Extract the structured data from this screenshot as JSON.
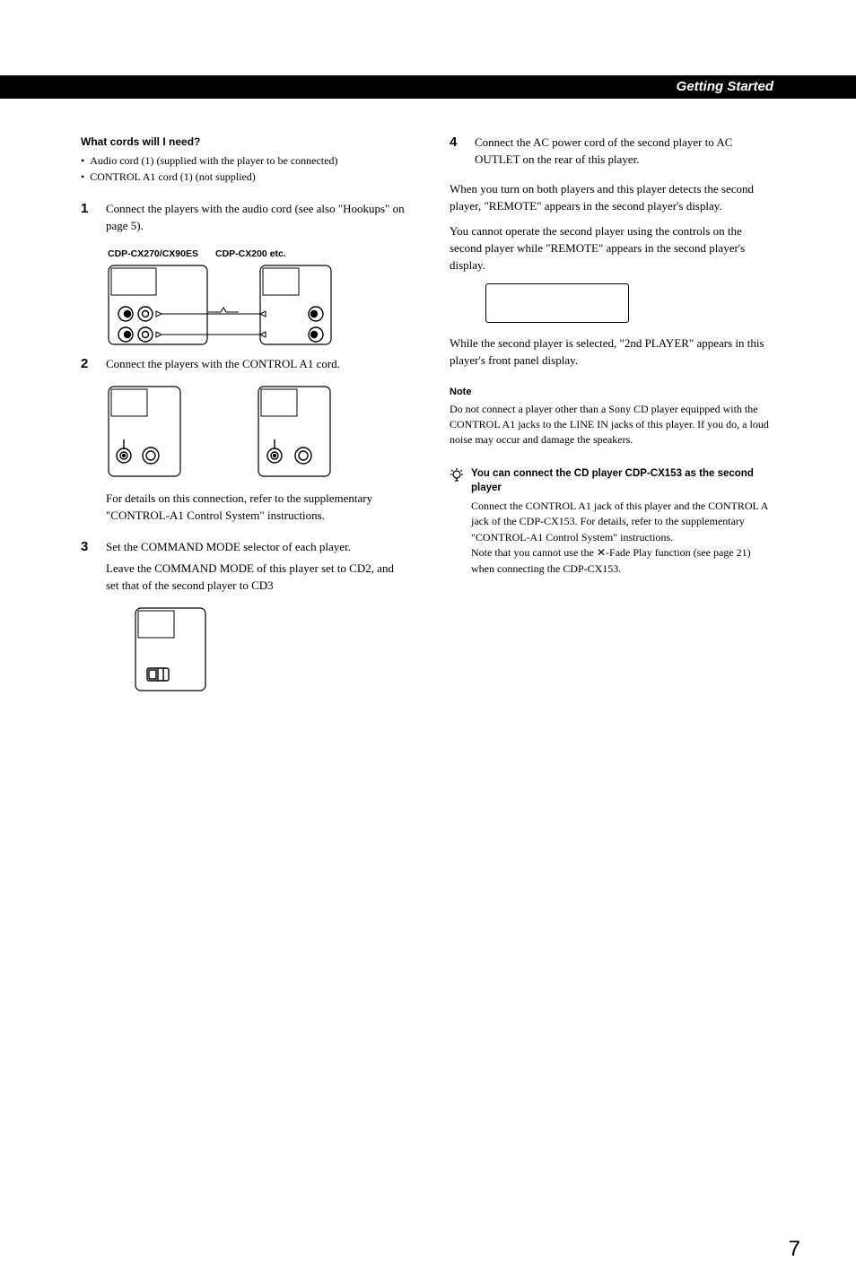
{
  "header": {
    "section_title": "Getting Started"
  },
  "left": {
    "cords_head": "What cords will I need?",
    "bullet1": "Audio cord (1) (supplied with the player to be connected)",
    "bullet2": "CONTROL A1 cord (1) (not supplied)",
    "step1": {
      "num": "1",
      "text": "Connect the players with the audio cord (see also \"Hookups\" on page 5)."
    },
    "diag1": {
      "left_label": "CDP-CX270/CX90ES",
      "right_label": "CDP-CX200 etc."
    },
    "step2": {
      "num": "2",
      "text": "Connect the players with the CONTROL A1 cord.",
      "tail": "For details on this connection, refer to the supplementary \"CONTROL-A1 Control System\" instructions."
    },
    "step3": {
      "num": "3",
      "line1": "Set the COMMAND MODE selector of each player.",
      "line2": "Leave the COMMAND MODE of this player set to CD2, and set that of the second player to CD3"
    }
  },
  "right": {
    "step4": {
      "num": "4",
      "text": "Connect the AC power cord of the second player to AC OUTLET on the rear of this player."
    },
    "p1": "When you turn on both players and this player detects the second player, \"REMOTE\" appears in the second player's display.",
    "p2": "You cannot operate the second player using the controls on the second player while \"REMOTE\" appears in the second player's display.",
    "p3": "While the second player is selected, \"2nd PLAYER\" appears in this player's front panel display.",
    "note_head": "Note",
    "note_body": "Do not connect a player other than a Sony CD player equipped with the CONTROL A1 jacks to the LINE IN jacks of this player. If you do, a loud noise may occur and damage the speakers.",
    "tip_title": "You can connect the CD player CDP-CX153 as the second player",
    "tip_body1": "Connect the CONTROL A1 jack of this player and the CONTROL A jack of the CDP-CX153. For details, refer to the supplementary \"CONTROL-A1 Control System\" instructions.",
    "tip_body2a": "Note that you cannot use the ",
    "tip_body2b": "-Fade Play function (see page 21) when connecting the CDP-CX153."
  },
  "page_number": "7"
}
